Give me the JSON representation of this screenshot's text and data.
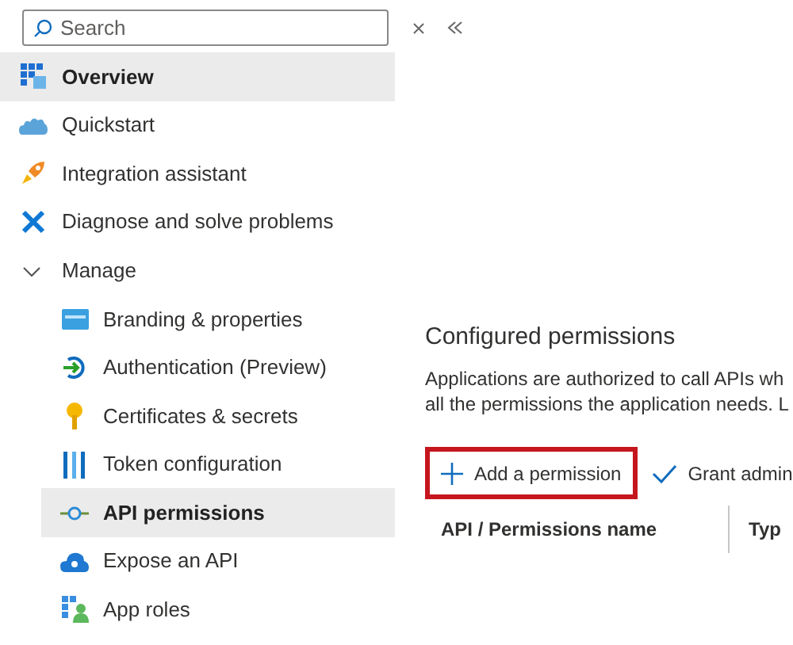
{
  "search": {
    "placeholder": "Search"
  },
  "sidebar": {
    "items": [
      {
        "label": "Overview",
        "selected": true
      },
      {
        "label": "Quickstart",
        "selected": false
      },
      {
        "label": "Integration assistant",
        "selected": false
      },
      {
        "label": "Diagnose and solve problems",
        "selected": false
      },
      {
        "label": "Manage",
        "expanded": true,
        "selected": false,
        "children": [
          {
            "label": "Branding & properties",
            "selected": false
          },
          {
            "label": "Authentication (Preview)",
            "selected": false
          },
          {
            "label": "Certificates & secrets",
            "selected": false
          },
          {
            "label": "Token configuration",
            "selected": false
          },
          {
            "label": "API permissions",
            "selected": true
          },
          {
            "label": "Expose an API",
            "selected": false
          },
          {
            "label": "App roles",
            "selected": false
          }
        ]
      }
    ]
  },
  "content": {
    "title": "Configured permissions",
    "description": [
      "Applications are authorized to call APIs wh",
      "all the permissions the application needs. L"
    ],
    "toolbar": [
      {
        "label": "Add a permission",
        "highlighted": true
      },
      {
        "label": "Grant admin",
        "highlighted": false
      }
    ],
    "table": {
      "columns": [
        "API / Permissions name",
        "Typ"
      ]
    }
  }
}
